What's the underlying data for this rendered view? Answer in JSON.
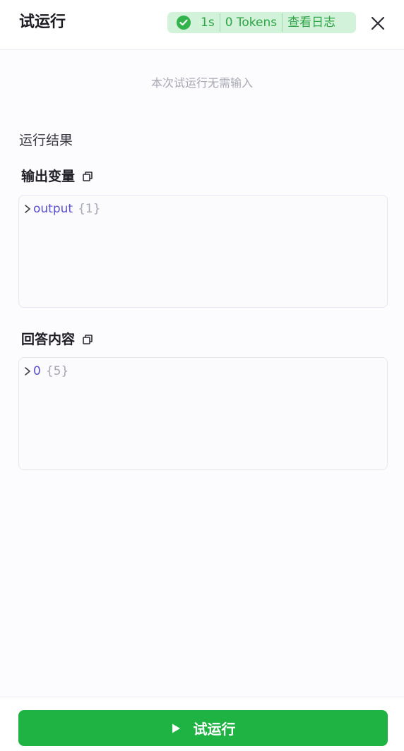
{
  "header": {
    "title": "试运行",
    "status": {
      "duration": "1s",
      "tokens": "0 Tokens",
      "view_log": "查看日志",
      "color": "#32b34c"
    },
    "close_icon": "close-icon"
  },
  "main": {
    "hint": "本次试运行无需输入",
    "result_title": "运行结果",
    "output_vars": {
      "label": "输出变量",
      "json": {
        "key": "output",
        "count": "{1}"
      }
    },
    "answer": {
      "label": "回答内容",
      "json": {
        "key": "0",
        "count": "{5}"
      }
    }
  },
  "footer": {
    "run_label": "试运行",
    "run_color": "#1fb343"
  }
}
